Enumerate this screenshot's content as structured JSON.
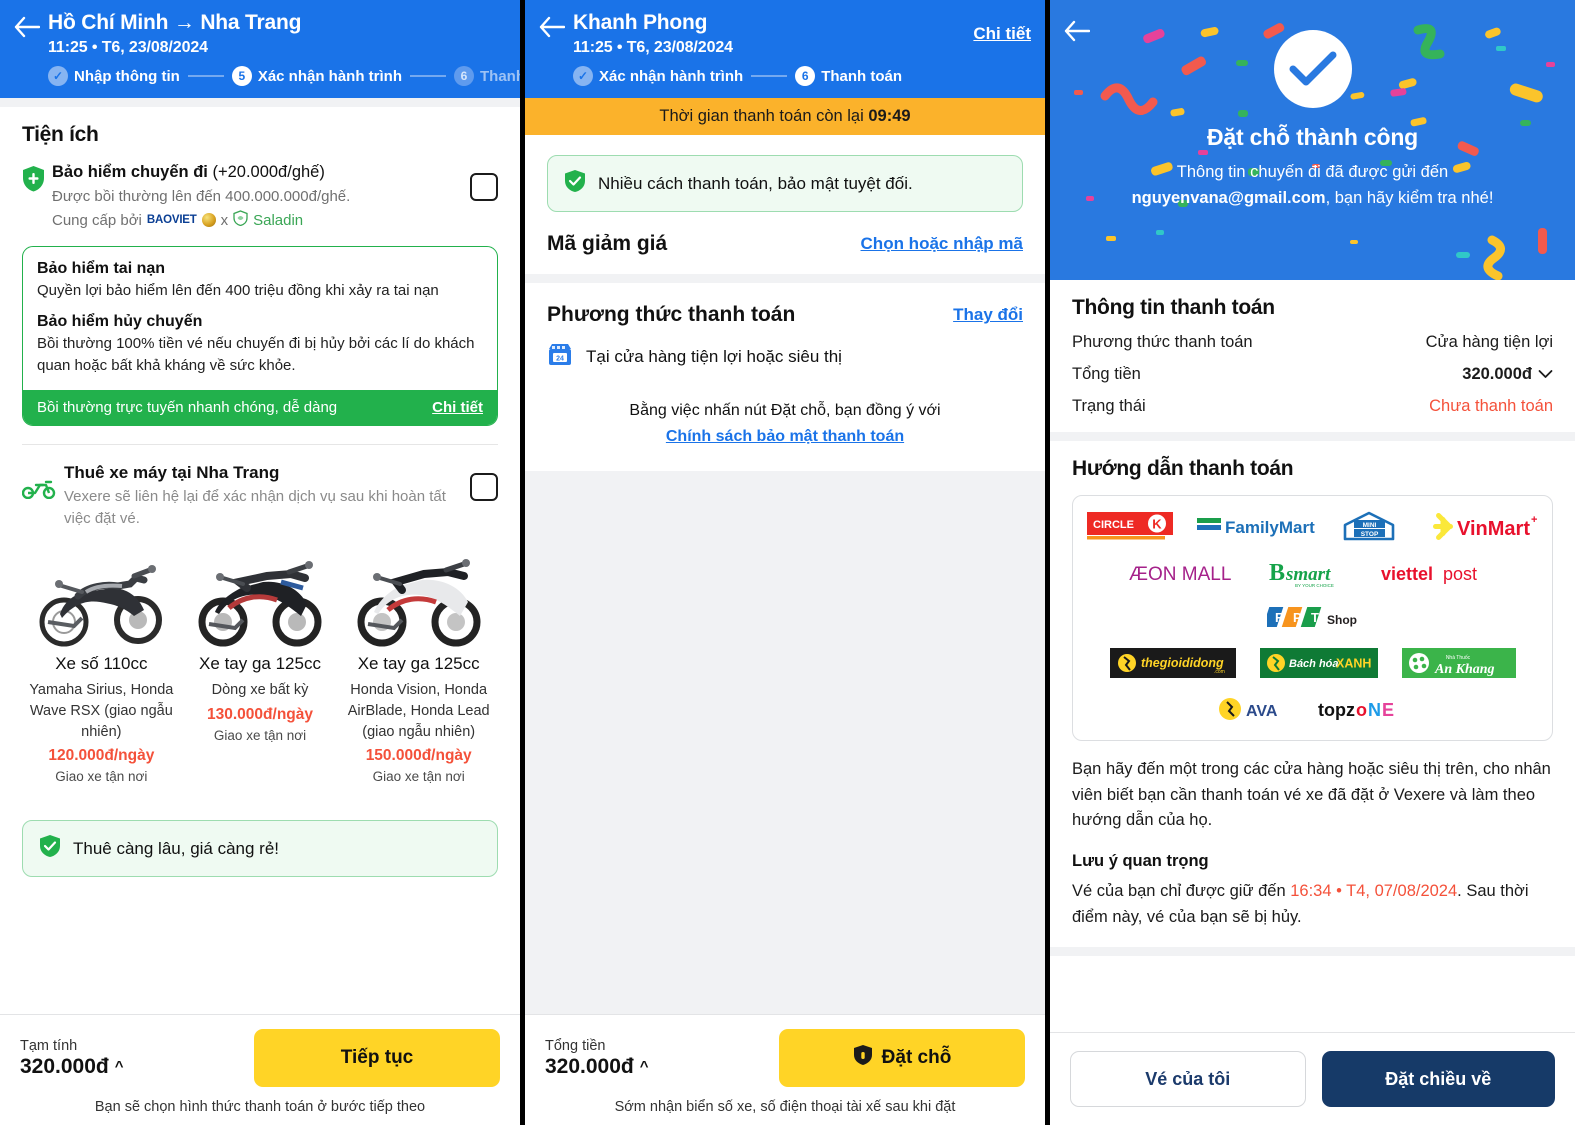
{
  "panel1": {
    "header": {
      "route": "Hồ Chí Minh → Nha Trang",
      "datetime": "11:25 • T6, 23/08/2024",
      "steps": [
        {
          "num": "✓",
          "label": "Nhập thông tin",
          "state": "done"
        },
        {
          "num": "5",
          "label": "Xác nhận hành trình",
          "state": "cur"
        },
        {
          "num": "6",
          "label": "Thanh",
          "state": "next"
        }
      ]
    },
    "amenities_title": "Tiện ích",
    "insurance": {
      "title_bold": "Bảo hiểm chuyến đi",
      "title_rest": " (+20.000đ/ghế)",
      "sub": "Được bồi thường lên đến 400.000.000đ/ghế.",
      "provider_prefix": "Cung cấp bởi",
      "provider_a": "BAOVIET",
      "provider_x": "x",
      "provider_b": "Saladin",
      "blocks": [
        {
          "h": "Bảo hiểm tai nạn",
          "p": "Quyền lợi bảo hiểm lên đến 400 triệu đồng khi xảy ra tai nạn"
        },
        {
          "h": "Bảo hiểm hủy chuyến",
          "p": "Bồi thường 100% tiền vé nếu chuyến đi bị hủy bởi các lí do khách quan hoặc bất khả kháng về sức khỏe."
        }
      ],
      "footer_text": "Bồi thường trực tuyến nhanh chóng, dễ dàng",
      "footer_link": "Chi tiết"
    },
    "rental": {
      "title": "Thuê xe máy tại Nha Trang",
      "sub": "Vexere sẽ liên hệ lại để xác nhận dịch vụ sau khi hoàn tất việc đặt vé.",
      "bikes": [
        {
          "name": "Xe số 110cc",
          "desc": "Yamaha Sirius, Honda Wave RSX (giao ngẫu nhiên)",
          "price": "120.000đ/ngày",
          "delivery": "Giao xe tận nơi"
        },
        {
          "name": "Xe tay ga 125cc",
          "desc": "Dòng xe bất kỳ",
          "price": "130.000đ/ngày",
          "delivery": "Giao xe tận nơi"
        },
        {
          "name": "Xe tay ga 125cc",
          "desc": "Honda Vision, Honda AirBlade, Honda Lead (giao ngẫu nhiên)",
          "price": "150.000đ/ngày",
          "delivery": "Giao xe tận nơi"
        }
      ],
      "tip": "Thuê càng lâu, giá càng rẻ!"
    },
    "footer": {
      "label": "Tạm tính",
      "price": "320.000đ",
      "button": "Tiếp tục",
      "note": "Bạn sẽ chọn hình thức thanh toán ở bước tiếp theo"
    }
  },
  "panel2": {
    "header": {
      "title": "Khanh Phong",
      "datetime": "11:25 • T6, 23/08/2024",
      "detail_link": "Chi tiết",
      "steps": [
        {
          "num": "✓",
          "label": "Xác nhận hành trình",
          "state": "done"
        },
        {
          "num": "6",
          "label": "Thanh toán",
          "state": "cur"
        }
      ]
    },
    "timer_prefix": "Thời gian thanh toán còn lại",
    "timer_value": "09:49",
    "secure_note": "Nhiều cách thanh toán, bảo mật tuyệt đối.",
    "promo": {
      "title": "Mã giảm giá",
      "link": "Chọn hoặc nhập mã"
    },
    "method": {
      "title": "Phương thức thanh toán",
      "link": "Thay đổi",
      "value": "Tại cửa hàng tiện lợi hoặc siêu thị"
    },
    "agree_text": "Bằng việc nhấn nút Đặt chỗ, bạn đồng ý với",
    "agree_link": "Chính sách bảo mật thanh toán",
    "footer": {
      "label": "Tổng tiền",
      "price": "320.000đ",
      "button": "Đặt chỗ",
      "note": "Sớm nhận biển số xe, số điện thoại tài xế sau khi đặt"
    }
  },
  "panel3": {
    "success": {
      "title": "Đặt chỗ thành công",
      "line1": "Thông tin chuyến đi đã được gửi đến",
      "email": "nguyenvana@gmail.com",
      "line2": ", bạn hãy kiểm tra nhé!"
    },
    "payinfo": {
      "title": "Thông tin thanh toán",
      "rows": [
        {
          "k": "Phương thức thanh toán",
          "v": "Cửa hàng tiện lợi",
          "style": "plain"
        },
        {
          "k": "Tổng tiền",
          "v": "320.000đ",
          "style": "bold"
        },
        {
          "k": "Trạng thái",
          "v": "Chưa thanh toán",
          "style": "red"
        }
      ]
    },
    "guide": {
      "title": "Hướng dẫn thanh toán",
      "logos_row1": [
        "CIRCLE K",
        "FamilyMart",
        "MINI STOP",
        "VinMart"
      ],
      "logos_row2": [
        "ÆON MALL",
        "B's mart",
        "viettel post",
        "FPT Shop"
      ],
      "logos_row3": [
        "thegioididong",
        "Bách hóa XANH",
        "An Khang"
      ],
      "logos_row4": [
        "AVA",
        "topzone"
      ],
      "paragraph": "Bạn hãy đến một trong các cửa hàng hoặc siêu thị trên, cho nhân viên biết bạn cần thanh toán vé xe đã đặt ở Vexere và làm theo hướng dẫn của họ.",
      "note_title": "Lưu ý quan trọng",
      "note_pre": "Vé của bạn chỉ được giữ đến ",
      "note_date": "16:34 • T4, 07/08/2024",
      "note_post": ". Sau thời điểm này, vé của bạn sẽ bị hủy."
    },
    "footer": {
      "btn_secondary": "Vé của tôi",
      "btn_primary": "Đặt chiều về"
    }
  },
  "colors": {
    "brand_blue": "#1a73e8",
    "success_blue": "#2979e0",
    "yellow": "#ffd426",
    "green": "#22b14c",
    "red": "#f4513a",
    "orange": "#fbb22b",
    "navy": "#163a68"
  }
}
